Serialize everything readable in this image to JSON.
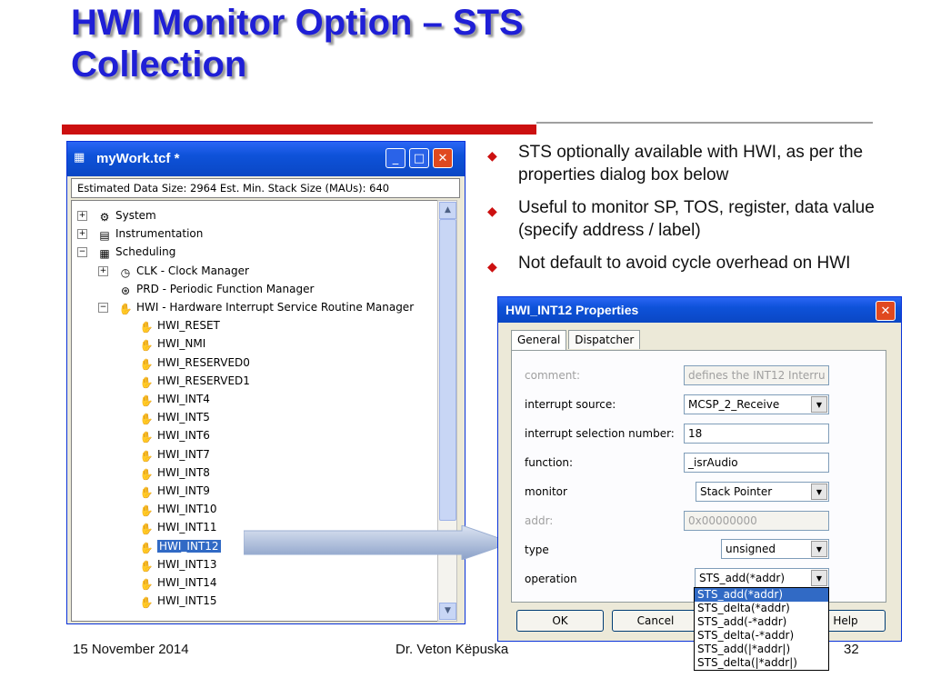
{
  "slide": {
    "title_line1": "HWI Monitor Option – STS",
    "title_line2": "Collection",
    "bullets": [
      "STS optionally available with HWI, as per the properties dialog box below",
      "Useful to monitor SP, TOS, register, data value (specify address / label)",
      "Not default to avoid cycle overhead on HWI"
    ],
    "footer": {
      "date": "15 November 2014",
      "author": "Dr. Veton Këpuska",
      "page": "32"
    }
  },
  "tree_window": {
    "title": "myWork.tcf *",
    "status": "Estimated Data Size: 2964   Est. Min. Stack Size (MAUs): 640",
    "items": [
      {
        "label": "System",
        "icon": "system-icon",
        "expander": "+"
      },
      {
        "label": "Instrumentation",
        "icon": "instrumentation-icon",
        "expander": "+"
      },
      {
        "label": "Scheduling",
        "icon": "scheduling-icon",
        "expander": "−"
      },
      {
        "label": "CLK - Clock Manager",
        "icon": "clock-icon",
        "expander": "+"
      },
      {
        "label": "PRD - Periodic Function Manager",
        "icon": "periodic-icon",
        "expander": ""
      },
      {
        "label": "HWI - Hardware Interrupt Service Routine Manager",
        "icon": "hand-icon",
        "expander": "−"
      },
      {
        "label": "HWI_RESET",
        "icon": "hand-icon"
      },
      {
        "label": "HWI_NMI",
        "icon": "hand-icon"
      },
      {
        "label": "HWI_RESERVED0",
        "icon": "hand-icon"
      },
      {
        "label": "HWI_RESERVED1",
        "icon": "hand-icon"
      },
      {
        "label": "HWI_INT4",
        "icon": "hand-icon"
      },
      {
        "label": "HWI_INT5",
        "icon": "hand-icon"
      },
      {
        "label": "HWI_INT6",
        "icon": "hand-icon"
      },
      {
        "label": "HWI_INT7",
        "icon": "hand-icon"
      },
      {
        "label": "HWI_INT8",
        "icon": "hand-icon"
      },
      {
        "label": "HWI_INT9",
        "icon": "hand-icon"
      },
      {
        "label": "HWI_INT10",
        "icon": "hand-icon"
      },
      {
        "label": "HWI_INT11",
        "icon": "hand-icon"
      },
      {
        "label": "HWI_INT12",
        "icon": "hand-icon",
        "selected": true
      },
      {
        "label": "HWI_INT13",
        "icon": "hand-icon"
      },
      {
        "label": "HWI_INT14",
        "icon": "hand-icon"
      },
      {
        "label": "HWI_INT15",
        "icon": "hand-icon"
      }
    ]
  },
  "dialog": {
    "title": "HWI_INT12 Properties",
    "tabs": [
      "General",
      "Dispatcher"
    ],
    "active_tab": "General",
    "properties": {
      "comment_label": "comment:",
      "comment_value": "defines the INT12 Interru",
      "source_label": "interrupt source:",
      "source_value": "MCSP_2_Receive",
      "selnum_label": "interrupt selection number:",
      "selnum_value": "18",
      "function_label": "function:",
      "function_value": "_isrAudio",
      "monitor_label": "monitor",
      "monitor_value": "Stack Pointer",
      "addr_label": "addr:",
      "addr_value": "0x00000000",
      "type_label": "type",
      "type_value": "unsigned",
      "operation_label": "operation",
      "operation_value": "STS_add(*addr)"
    },
    "operation_options": [
      "STS_add(*addr)",
      "STS_delta(*addr)",
      "STS_add(-*addr)",
      "STS_delta(-*addr)",
      "STS_add(|*addr|)",
      "STS_delta(|*addr|)"
    ],
    "buttons": {
      "ok": "OK",
      "cancel": "Cancel",
      "help": "Help"
    }
  },
  "colors": {
    "title": "#1f1fd6",
    "accent_rule": "#cc1010",
    "bullet": "#cc1010",
    "xp_blue": "#0e52d9",
    "selection": "#316ac5"
  }
}
